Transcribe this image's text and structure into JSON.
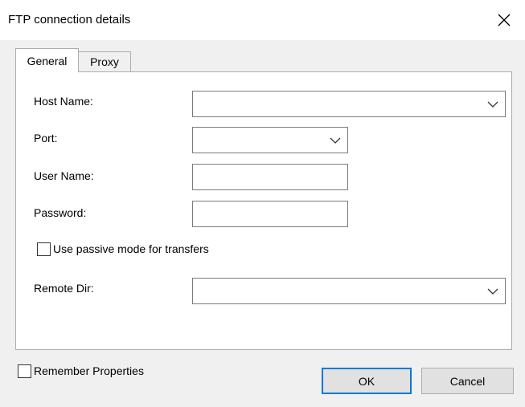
{
  "window": {
    "title": "FTP connection details",
    "close_icon": "close-icon"
  },
  "tabs": [
    {
      "label": "General",
      "selected": true
    },
    {
      "label": "Proxy",
      "selected": false
    }
  ],
  "form": {
    "host_name_label": "Host Name:",
    "host_name_value": "",
    "port_label": "Port:",
    "port_value": "",
    "user_name_label": "User Name:",
    "user_name_value": "",
    "password_label": "Password:",
    "password_value": "",
    "passive_mode_label": "Use passive mode for transfers",
    "passive_mode_checked": false,
    "remote_dir_label": "Remote Dir:",
    "remote_dir_value": ""
  },
  "footer": {
    "remember_label": "Remember Properties",
    "remember_checked": false,
    "ok_label": "OK",
    "cancel_label": "Cancel"
  },
  "colors": {
    "dialog_bg": "#f0f0f0",
    "focus_accent": "#0078d7",
    "border": "#7a7a7a"
  }
}
